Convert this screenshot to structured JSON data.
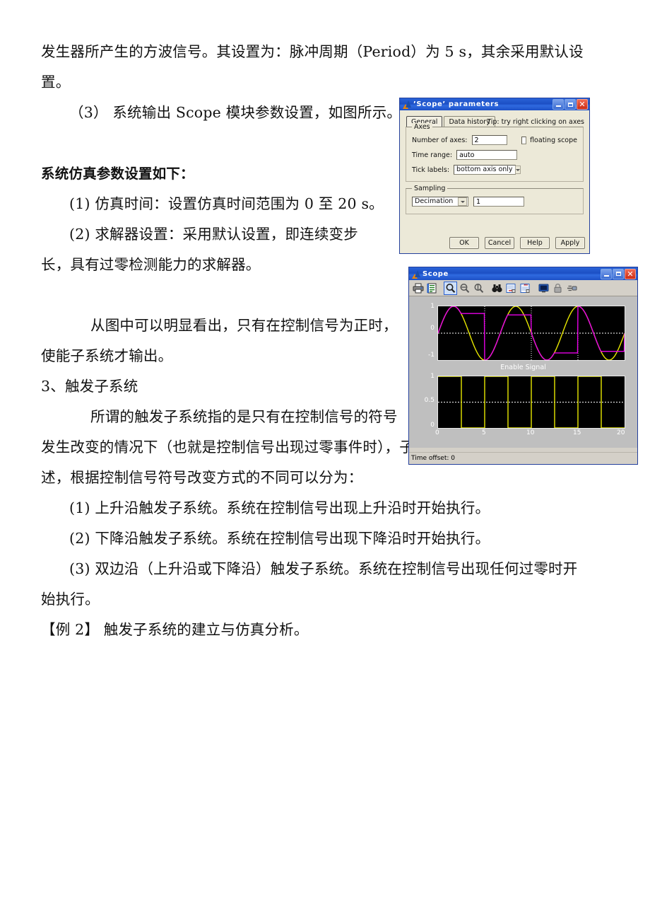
{
  "document": {
    "lines": [
      {
        "text": "发生器所产生的方波信号。其设置为：脉冲周期（Period）为 5 s，其余采用默认设",
        "indent": 0,
        "bold": false
      },
      {
        "text": "置。",
        "indent": 0,
        "bold": false
      },
      {
        "text": "（3） 系统输出 Scope 模块参数设置，如图所示。",
        "indent": 1,
        "bold": false
      },
      {
        "text": "",
        "indent": 0,
        "bold": false
      },
      {
        "text": "系统仿真参数设置如下：",
        "indent": 0,
        "bold": true
      },
      {
        "text": "(1) 仿真时间：设置仿真时间范围为 0 至 20 s。",
        "indent": 1,
        "bold": false
      },
      {
        "text": "(2) 求解器设置：采用默认设置，即连续变步",
        "indent": 1,
        "bold": false
      },
      {
        "text": "长，具有过零检测能力的求解器。",
        "indent": 0,
        "bold": false
      },
      {
        "text": "",
        "indent": 0,
        "bold": false
      },
      {
        "text": "从图中可以明显看出，只有在控制信号为正时，",
        "indent": 2,
        "bold": false
      },
      {
        "text": "使能子系统才输出。",
        "indent": 0,
        "bold": false
      },
      {
        "text": "3、触发子系统",
        "indent": 0,
        "bold": false
      },
      {
        "text": "所谓的触发子系统指的是只有在控制信号的符号",
        "indent": 2,
        "bold": false
      },
      {
        "text": "发生改变的情况下（也就是控制信号出现过零事件时），子系统才开始执行。如前所",
        "indent": 0,
        "bold": false
      },
      {
        "text": "述，根据控制信号符号改变方式的不同可以分为：",
        "indent": 0,
        "bold": false
      },
      {
        "text": "(1) 上升沿触发子系统。系统在控制信号出现上升沿时开始执行。",
        "indent": 1,
        "bold": false
      },
      {
        "text": "(2) 下降沿触发子系统。系统在控制信号出现下降沿时开始执行。",
        "indent": 1,
        "bold": false
      },
      {
        "text": "(3) 双边沿（上升沿或下降沿）触发子系统。系统在控制信号出现任何过零时开",
        "indent": 1,
        "bold": false
      },
      {
        "text": "始执行。",
        "indent": 0,
        "bold": false
      },
      {
        "text": "【例 2】 触发子系统的建立与仿真分析。",
        "indent": 0,
        "bold": false
      }
    ]
  },
  "scope_params_dialog": {
    "title": "’Scope’ parameters",
    "window_buttons": {
      "minimize": "minimize-icon",
      "maximize": "maximize-icon",
      "close": "close-icon"
    },
    "tabs": [
      {
        "label": "General",
        "active": true
      },
      {
        "label": "Data history",
        "active": false
      }
    ],
    "tip": "Tip: try right clicking on axes",
    "axes_group": {
      "legend": "Axes",
      "number_of_axes_label": "Number of axes:",
      "number_of_axes_value": "2",
      "floating_scope_label": "floating scope",
      "floating_scope_checked": false,
      "time_range_label": "Time range:",
      "time_range_value": "auto",
      "tick_labels_label": "Tick labels:",
      "tick_labels_value": "bottom axis only"
    },
    "sampling_group": {
      "legend": "Sampling",
      "mode_value": "Decimation",
      "mode_amount": "1"
    },
    "buttons": [
      {
        "label": "OK"
      },
      {
        "label": "Cancel"
      },
      {
        "label": "Help"
      },
      {
        "label": "Apply"
      }
    ]
  },
  "scope_window": {
    "title": "Scope",
    "toolbar": [
      {
        "name": "print-icon",
        "selected": false
      },
      {
        "name": "parameters-icon",
        "selected": false
      },
      {
        "name": "zoom-icon",
        "selected": true
      },
      {
        "name": "zoom-x-icon",
        "selected": false
      },
      {
        "name": "zoom-y-icon",
        "selected": false
      },
      {
        "name": "autoscale-binoculars-icon",
        "selected": false
      },
      {
        "name": "save-axes-settings-icon",
        "selected": false
      },
      {
        "name": "restore-axes-settings-icon",
        "selected": false
      },
      {
        "name": "floating-scope-icon",
        "selected": false
      },
      {
        "name": "lock-axes-icon",
        "selected": false
      },
      {
        "name": "signal-selection-icon",
        "selected": false
      }
    ],
    "status": "Time offset:  0",
    "colors": {
      "signal_yellow": "#e8e800",
      "signal_magenta": "#e800e8",
      "plot_background": "#000000",
      "grid": "#ffffff",
      "window_background": "#bfbfbf"
    }
  },
  "chart_data": [
    {
      "type": "line",
      "title": "",
      "xlabel": "",
      "ylabel": "",
      "xlim": [
        0,
        20
      ],
      "ylim": [
        -1,
        1
      ],
      "yticks": [
        1,
        0,
        -1
      ],
      "ytick_labels": [
        "1",
        "0",
        "-1"
      ],
      "xticks": [
        0,
        5,
        10,
        15,
        20
      ],
      "xtick_labels": [],
      "grid": true,
      "legend": null,
      "series": [
        {
          "name": "sine-wave-source",
          "color": "#e8e800",
          "description": "Sine wave, amplitude 1, period 6.67 s",
          "amplitude": 1,
          "period": 6.67,
          "phase": 0
        },
        {
          "name": "enabled-subsystem-output",
          "color": "#e800e8",
          "description": "Sine wave passed through enabled subsystem; holds last value while enable signal is low",
          "amplitude": 1,
          "period": 6.67,
          "enable_period": 5,
          "enable_duty_percent": 50
        }
      ]
    },
    {
      "type": "line",
      "title": "Enable Signal",
      "xlabel": "",
      "ylabel": "",
      "xlim": [
        0,
        20
      ],
      "ylim": [
        0,
        1
      ],
      "yticks": [
        1,
        0.5,
        0
      ],
      "ytick_labels": [
        "1",
        "0.5",
        "0"
      ],
      "xticks": [
        0,
        5,
        10,
        15,
        20
      ],
      "xtick_labels": [
        "0",
        "5",
        "10",
        "15",
        "20"
      ],
      "grid": true,
      "legend": null,
      "series": [
        {
          "name": "pulse-generator-square-wave",
          "color": "#e8e800",
          "description": "Square wave pulse generator, period 5 s, 50% duty cycle, amplitude 1",
          "period": 5,
          "duty_percent": 50,
          "amplitude": 1
        }
      ]
    }
  ]
}
